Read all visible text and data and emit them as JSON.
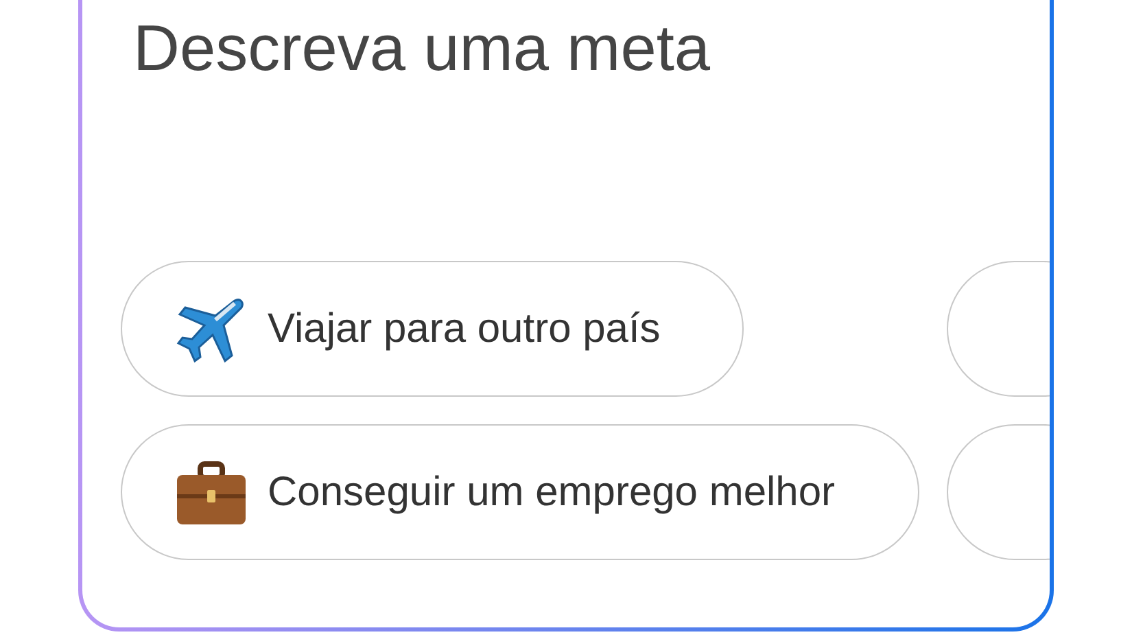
{
  "goal_input": {
    "placeholder": "Descreva uma meta"
  },
  "suggestion_rows": [
    {
      "chips": [
        {
          "kind": "airplane",
          "label": "Viajar para outro país"
        }
      ],
      "clipped_next": true
    },
    {
      "chips": [
        {
          "kind": "briefcase",
          "label": "Conseguir um emprego melhor"
        }
      ],
      "clipped_next": true
    }
  ]
}
